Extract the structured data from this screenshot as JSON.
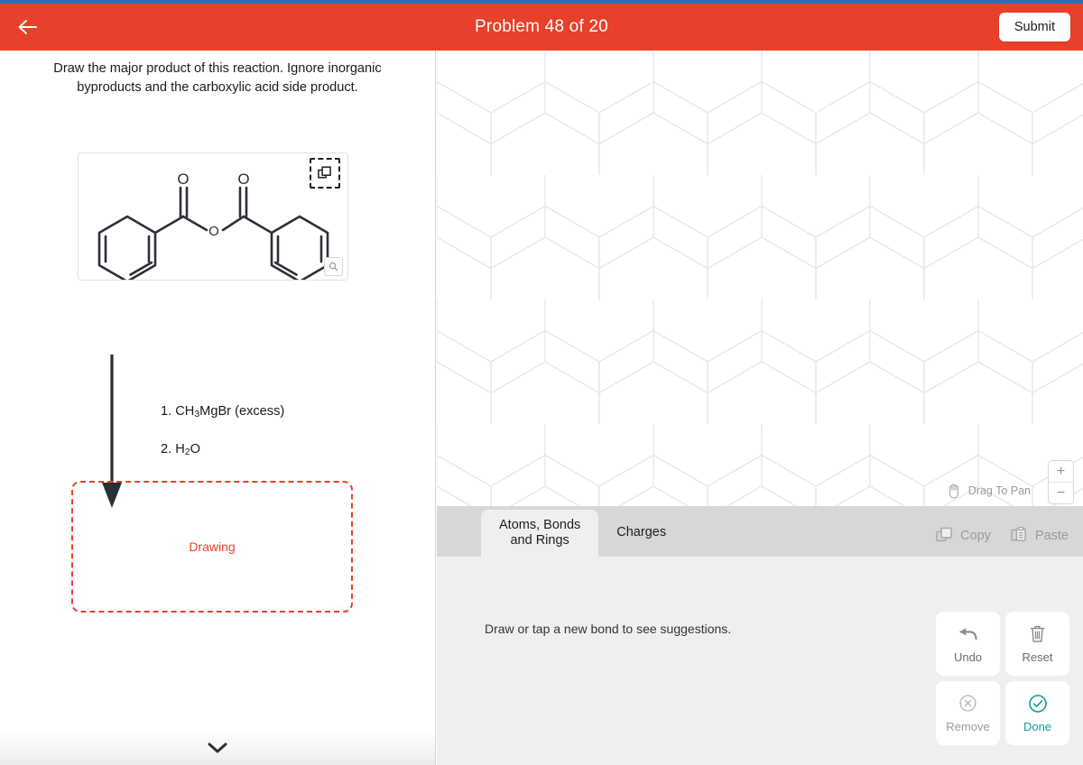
{
  "header": {
    "back_icon": "arrow-left-icon",
    "title": "Problem 48 of 20",
    "submit_label": "Submit",
    "bg_color": "#e8402a",
    "status_strip_color": "#2f6fb5"
  },
  "left": {
    "prompt": "Draw the major product of this reaction. Ignore inorganic byproducts and the carboxylic acid side product.",
    "molecule": {
      "name": "benzoic anhydride",
      "atom_labels": [
        "O",
        "O",
        "O"
      ],
      "copy_icon": "copy-icon",
      "zoom_icon": "magnifier-icon"
    },
    "reagents": [
      {
        "step": "1.",
        "text": "CH",
        "sub1": "3",
        "rest": "MgBr (excess)"
      },
      {
        "step": "2.",
        "text": "H",
        "sub1": "2",
        "rest": "O"
      }
    ],
    "reagent_lines": [
      "1. CH3MgBr (excess)",
      "2. H2O"
    ],
    "drop_zone_label": "Drawing",
    "drop_zone_color": "#e8402a",
    "expand_icon": "chevron-down-icon"
  },
  "canvas": {
    "grid": "hexagonal",
    "grid_color": "#e3e4e6",
    "pan_icon": "hand-icon",
    "pan_label": "Drag To Pan",
    "zoom_in_label": "+",
    "zoom_out_label": "−"
  },
  "toolbar": {
    "tabs": [
      {
        "label_line1": "Atoms, Bonds",
        "label_line2": "and Rings",
        "active": true
      },
      {
        "label_line1": "Charges",
        "label_line2": "",
        "active": false
      }
    ],
    "copy_label": "Copy",
    "copy_icon": "copy-icon",
    "paste_label": "Paste",
    "paste_icon": "clipboard-icon",
    "hint": "Draw or tap a new bond to see suggestions.",
    "buttons": [
      {
        "label": "Undo",
        "icon": "undo-arrow-icon",
        "state": "enabled"
      },
      {
        "label": "Reset",
        "icon": "trash-icon",
        "state": "enabled"
      },
      {
        "label": "Remove",
        "icon": "x-circle-icon",
        "state": "disabled"
      },
      {
        "label": "Done",
        "icon": "check-circle-icon",
        "state": "active",
        "color": "#0e9d96"
      }
    ]
  }
}
